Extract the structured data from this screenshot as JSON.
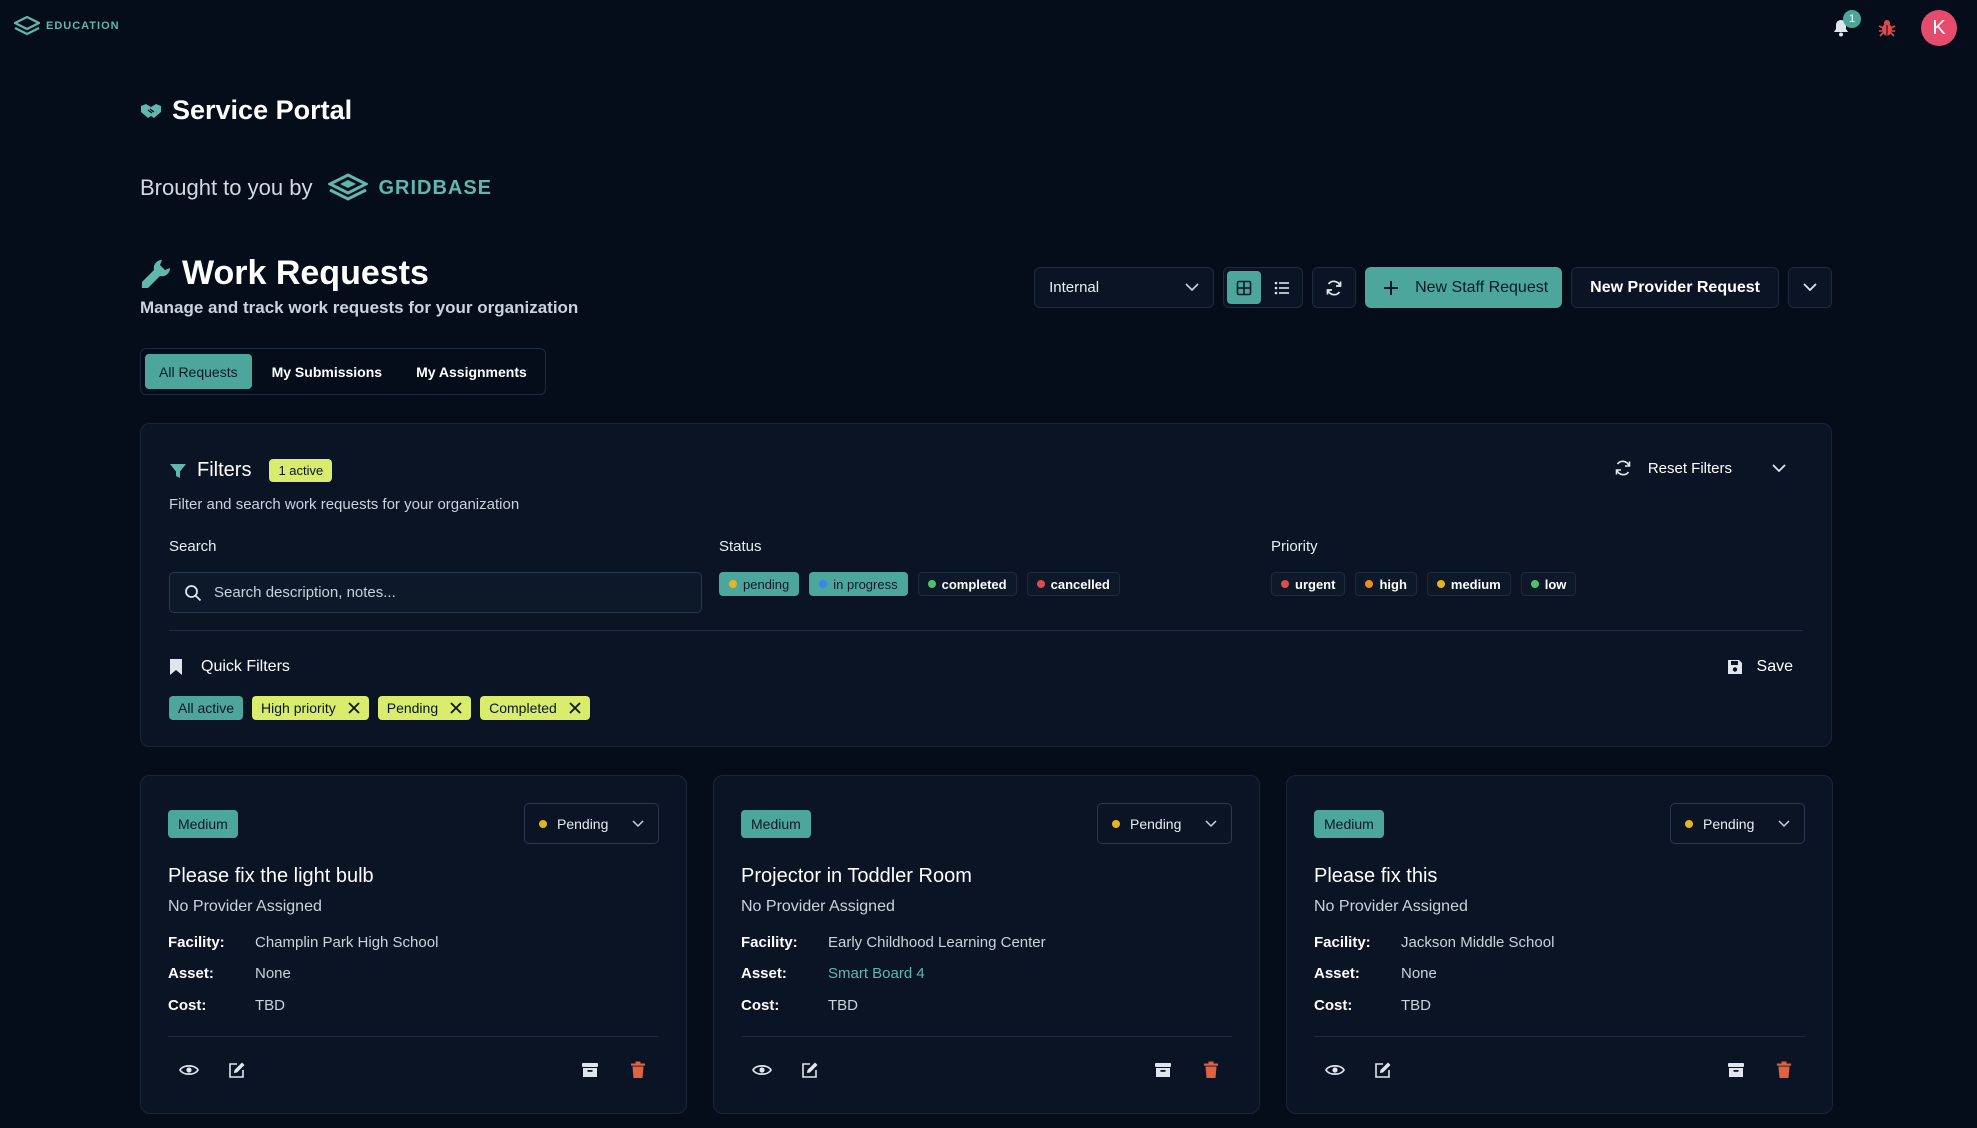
{
  "topbar": {
    "logo_text": "EDUCATION",
    "notification_count": "1",
    "avatar_initial": "K"
  },
  "portal": {
    "title": "Service Portal",
    "brought_by": "Brought to you by",
    "brand": "GRIDBASE"
  },
  "page": {
    "title": "Work Requests",
    "subtitle": "Manage and track work requests for your organization"
  },
  "toolbar": {
    "scope_value": "Internal",
    "new_staff_label": "New Staff Request",
    "new_provider_label": "New Provider Request"
  },
  "tabs": [
    {
      "label": "All Requests",
      "active": true
    },
    {
      "label": "My Submissions",
      "active": false
    },
    {
      "label": "My Assignments",
      "active": false
    }
  ],
  "filters": {
    "title": "Filters",
    "active_badge": "1 active",
    "subtitle": "Filter and search work requests for your organization",
    "reset_label": "Reset Filters",
    "search_label": "Search",
    "search_placeholder": "Search description, notes...",
    "status_label": "Status",
    "status_options": [
      {
        "label": "pending",
        "color": "#e5b51e",
        "selected": true
      },
      {
        "label": "in progress",
        "color": "#3b82f6",
        "selected": true
      },
      {
        "label": "completed",
        "color": "#4cc36b",
        "selected": false
      },
      {
        "label": "cancelled",
        "color": "#e14b4b",
        "selected": false
      }
    ],
    "priority_label": "Priority",
    "priority_options": [
      {
        "label": "urgent",
        "color": "#e14b4b"
      },
      {
        "label": "high",
        "color": "#f08a24"
      },
      {
        "label": "medium",
        "color": "#e5b51e"
      },
      {
        "label": "low",
        "color": "#4cc36b"
      }
    ],
    "quick_filters_label": "Quick Filters",
    "save_label": "Save",
    "quick_filters": [
      {
        "label": "All active",
        "style": "teal",
        "removable": false
      },
      {
        "label": "High priority",
        "style": "lime",
        "removable": true
      },
      {
        "label": "Pending",
        "style": "lime",
        "removable": true
      },
      {
        "label": "Completed",
        "style": "lime",
        "removable": true
      }
    ]
  },
  "field_labels": {
    "facility": "Facility:",
    "asset": "Asset:",
    "cost": "Cost:"
  },
  "cards": [
    {
      "priority": "Medium",
      "status": "Pending",
      "title": "Please fix the light bulb",
      "provider": "No Provider Assigned",
      "facility": "Champlin Park High School",
      "asset": "None",
      "asset_is_link": false,
      "cost": "TBD"
    },
    {
      "priority": "Medium",
      "status": "Pending",
      "title": "Projector in Toddler Room",
      "provider": "No Provider Assigned",
      "facility": "Early Childhood Learning Center",
      "asset": "Smart Board 4",
      "asset_is_link": true,
      "cost": "TBD"
    },
    {
      "priority": "Medium",
      "status": "Pending",
      "title": "Please fix this",
      "provider": "No Provider Assigned",
      "facility": "Jackson Middle School",
      "asset": "None",
      "asset_is_link": false,
      "cost": "TBD"
    }
  ],
  "colors": {
    "accent": "#4ca69c",
    "lime": "#d9ec6b",
    "background": "#050d1a",
    "panel": "#0b1424",
    "danger": "#e0623f"
  }
}
